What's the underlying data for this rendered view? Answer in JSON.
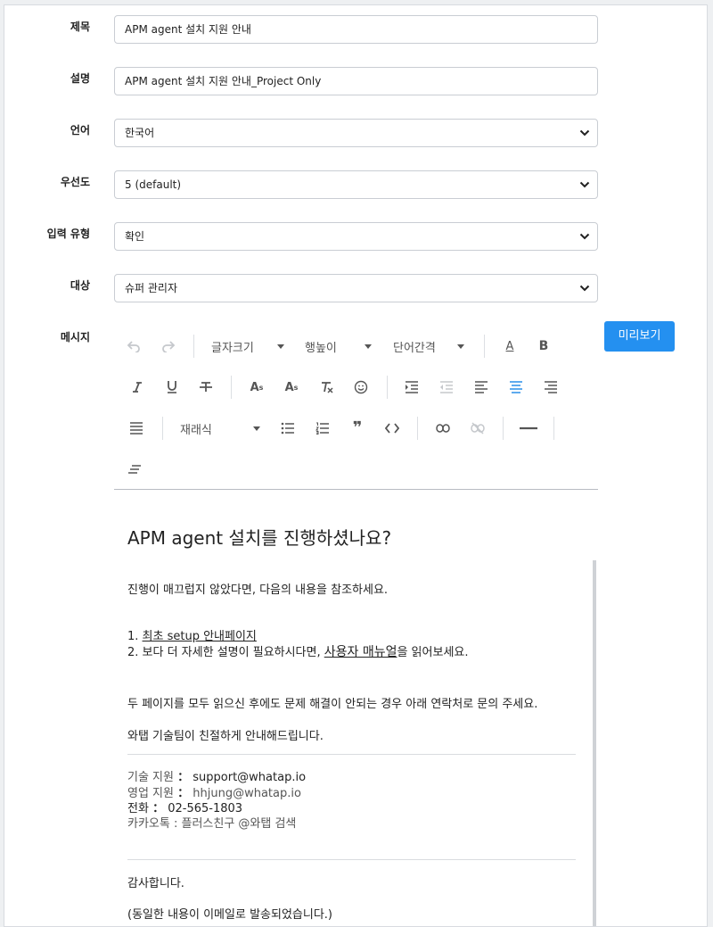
{
  "form": {
    "title": {
      "label": "제목",
      "value": "APM agent 설치 지원 안내"
    },
    "description": {
      "label": "설명",
      "value": "APM agent 설치 지원 안내_Project Only"
    },
    "language": {
      "label": "언어",
      "value": "한국어"
    },
    "priority": {
      "label": "우선도",
      "value": "5 (default)"
    },
    "input_type": {
      "label": "입력 유형",
      "value": "확인"
    },
    "target": {
      "label": "대상",
      "value": "슈퍼 관리자"
    },
    "message": {
      "label": "메시지"
    }
  },
  "preview_button": "미리보기",
  "toolbar": {
    "font_size": "글자크기",
    "line_height": "행높이",
    "letter_spacing": "단어간격",
    "bold": "B",
    "font_color": "A",
    "format": "재래식",
    "icons": [
      "undo-icon",
      "redo-icon",
      "font-color-icon",
      "bold-icon",
      "italic-icon",
      "underline-icon",
      "strikethrough-icon",
      "superscript-icon",
      "subscript-icon",
      "clear-format-icon",
      "emoji-icon",
      "indent-icon",
      "outdent-icon",
      "align-left-icon",
      "align-center-icon",
      "align-right-icon",
      "align-justify-icon",
      "bullet-list-icon",
      "numbered-list-icon",
      "quote-icon",
      "code-icon",
      "link-icon",
      "unlink-icon",
      "horizontal-rule-icon",
      "line-height-icon"
    ]
  },
  "editor": {
    "heading": "APM agent 설치를 진행하셨나요?",
    "p1": "진행이 매끄럽지 않았다면, 다음의 내용을 참조하세요.",
    "list1_prefix": "1. ",
    "list1_link": "최초 setup 안내페이지",
    "list2_prefix": "2. 보다 더 자세한 설명이 필요하시다면, ",
    "list2_link": "사용자 매뉴얼",
    "list2_suffix": "을 읽어보세요.",
    "p2": "두 페이지를 모두 읽으신 후에도 문제 해결이 안되는 경우 아래 연락처로 문의 주세요.",
    "p3": "와탭 기술팀이 친절하게 안내해드립니다.",
    "contact_tech_label": "기술 지원 ",
    "contact_tech_value": "support@whatap.io",
    "contact_sales_label": "영업 지원 ",
    "contact_sales_value": "hhjung@whatap.io",
    "contact_phone_label": "전화 ",
    "contact_phone_value": "02-565-1803",
    "contact_kakao": "카카오톡 : 플러스친구 @와탭 검색",
    "colon": "：",
    "thanks": "감사합니다.",
    "note": "(동일한 내용이 이메일로 발송되었습니다.)"
  }
}
